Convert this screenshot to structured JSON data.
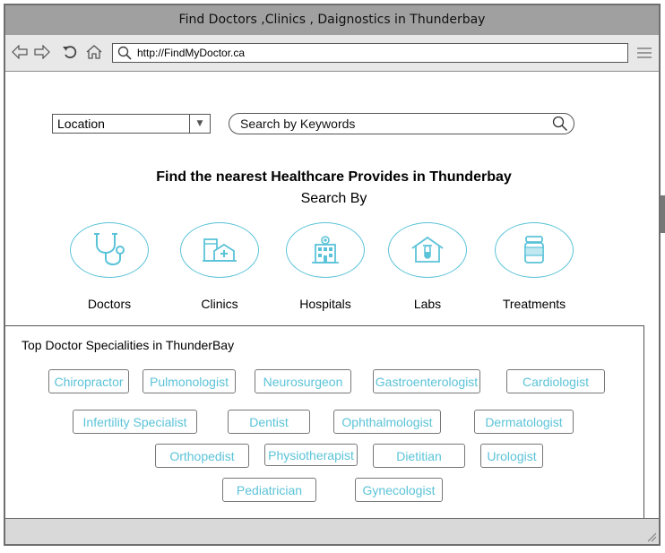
{
  "window": {
    "title": "Find Doctors ,Clinics , Daignostics in Thunderbay"
  },
  "browser": {
    "address": "http://FindMyDoctor.ca",
    "icons": [
      "back-arrow-icon",
      "forward-arrow-icon",
      "refresh-icon",
      "home-icon",
      "search-icon",
      "hamburger-menu-icon"
    ]
  },
  "filters": {
    "location_value": "Location",
    "search_placeholder": "Search by Keywords"
  },
  "hero": {
    "heading": "Find the nearest Healthcare Provides in Thunderbay",
    "subheading": "Search By"
  },
  "categories": [
    {
      "label": "Doctors",
      "icon": "stethoscope-icon"
    },
    {
      "label": "Clinics",
      "icon": "clinic-icon"
    },
    {
      "label": "Hospitals",
      "icon": "hospital-icon"
    },
    {
      "label": "Labs",
      "icon": "lab-icon"
    },
    {
      "label": "Treatments",
      "icon": "pill-bottle-icon"
    }
  ],
  "specialities": {
    "title": "Top Doctor Specialities in ThunderBay",
    "items": [
      "Chiropractor",
      "Pulmonologist",
      "Neurosurgeon",
      "Gastroenterologist",
      "Cardiologist",
      "Infertility Specialist",
      "Dentist",
      "Ophthalmologist",
      "Dermatologist",
      "Orthopedist",
      "Physiotherapist",
      "Dietitian",
      "Urologist",
      "Pediatrician",
      "Gynecologist"
    ]
  },
  "colors": {
    "accent": "#5bc3d8",
    "titlebar": "#a0a0a0",
    "toolbar": "#e8e8e8",
    "statusbar": "#d9d9d9"
  }
}
